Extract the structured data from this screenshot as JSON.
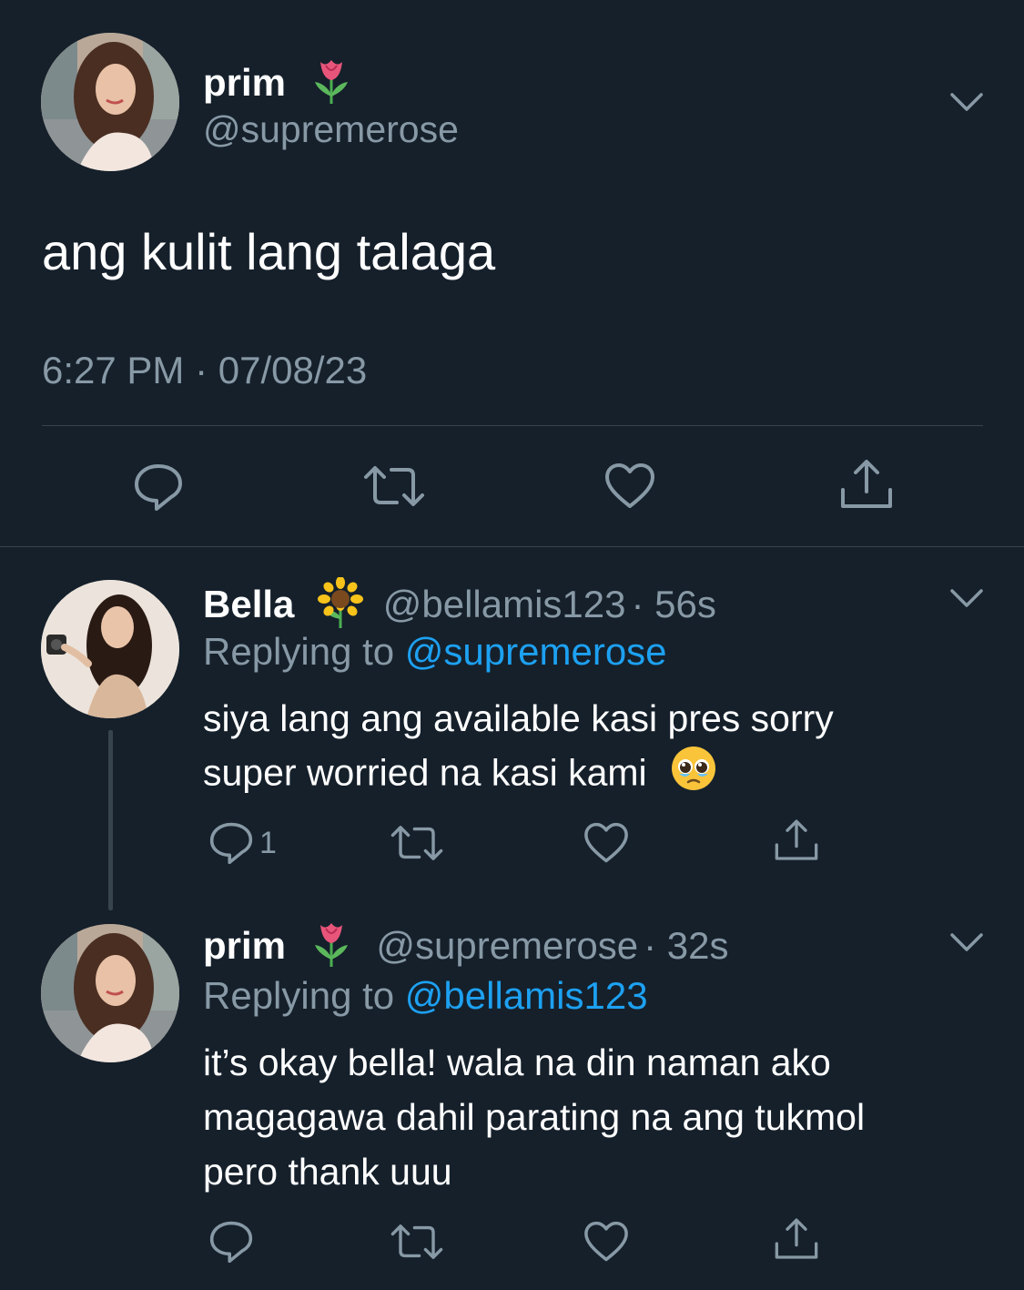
{
  "main_tweet": {
    "name": "prim",
    "name_emoji": "tulip-emoji",
    "handle": "@supremerose",
    "text": "ang kulit lang talaga",
    "timestamp": "6:27 PM · 07/08/23"
  },
  "replies": [
    {
      "name": "Bella",
      "name_emoji": "sunflower-emoji",
      "handle": "@bellamis123",
      "time": "· 56s",
      "replying_prefix": "Replying to",
      "replying_to": "@supremerose",
      "text_lines": [
        "siya lang ang available kasi pres sorry",
        "super worried na kasi kami"
      ],
      "text_emoji": "pleading-face-emoji",
      "reply_count": "1"
    },
    {
      "name": "prim",
      "name_emoji": "tulip-emoji",
      "handle": "@supremerose",
      "time": "· 32s",
      "replying_prefix": "Replying to",
      "replying_to": "@bellamis123",
      "text_lines": [
        "it’s okay bella! wala na din naman ako",
        "magagawa dahil parating na ang tukmol",
        "pero thank uuu"
      ]
    }
  ],
  "icons": {
    "reply": "reply-icon",
    "retweet": "retweet-icon",
    "like": "heart-icon",
    "share": "share-icon",
    "more": "chevron-down-icon"
  },
  "colors": {
    "background": "#15202b",
    "muted": "#8899a6",
    "link": "#1da1f2",
    "divider": "#38444d"
  }
}
